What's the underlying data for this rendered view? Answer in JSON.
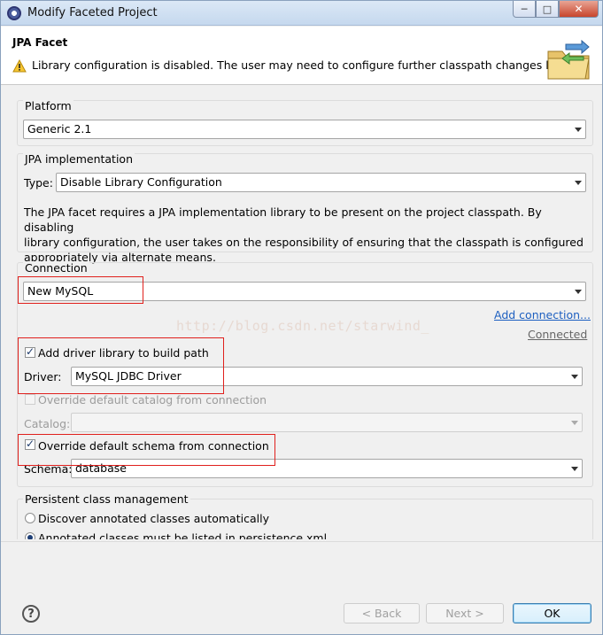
{
  "window": {
    "title": "Modify Faceted Project"
  },
  "header": {
    "title": "JPA Facet",
    "warning": "Library configuration is disabled. The user may need to configure further classpath changes later."
  },
  "platform": {
    "legend": "Platform",
    "value": "Generic 2.1"
  },
  "implementation": {
    "legend": "JPA implementation",
    "type_label": "Type:",
    "type_value": "Disable Library Configuration",
    "description_lines": [
      "The JPA facet requires a JPA implementation library to be present on the project classpath. By disabling",
      "library configuration, the user takes on the responsibility of ensuring that the classpath is configured",
      "appropriately via alternate means."
    ]
  },
  "connection": {
    "legend": "Connection",
    "value": "New MySQL",
    "add_link": "Add connection...",
    "status_link": "Connected",
    "add_driver_label": "Add driver library to build path",
    "driver_label": "Driver:",
    "driver_value": "MySQL JDBC Driver",
    "override_catalog_label": "Override default catalog from connection",
    "catalog_label": "Catalog:",
    "catalog_value": "",
    "override_schema_label": "Override default schema from connection",
    "schema_label": "Schema:",
    "schema_value": "database"
  },
  "persistent": {
    "legend": "Persistent class management",
    "option1": "Discover annotated classes automatically",
    "option2": "Annotated classes must be listed in persistence.xml"
  },
  "watermark": "http://blog.csdn.net/starwind_",
  "footer": {
    "help": "?",
    "back": "< Back",
    "next": "Next >",
    "ok": "OK"
  },
  "colors": {
    "highlight_box": "#e0201d",
    "link": "#1d5fc0"
  }
}
